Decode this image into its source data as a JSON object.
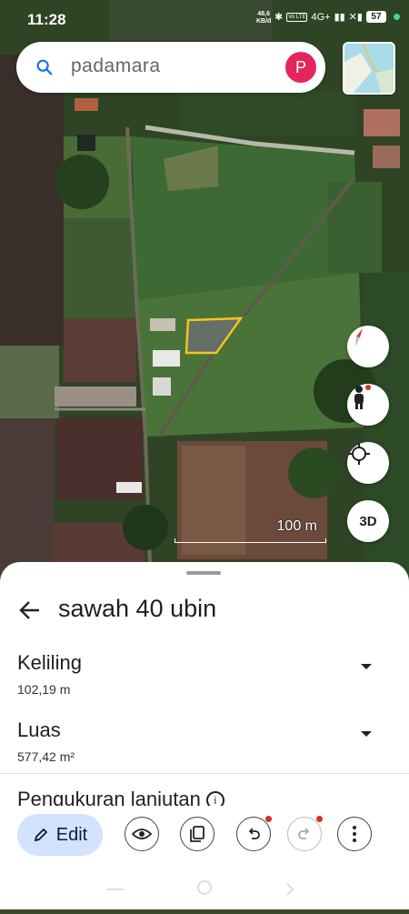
{
  "status_bar": {
    "time": "11:28",
    "net_speed": "48,6",
    "net_unit": "KB/d",
    "volte": "Vo LTE",
    "signal": "4G+",
    "battery": "57"
  },
  "search": {
    "query": "padamara",
    "avatar_letter": "P"
  },
  "map": {
    "scale_label": "100 m",
    "btn_3d": "3D",
    "measured_polygon_color": "#f5c518"
  },
  "sheet": {
    "title": "sawah 40 ubin",
    "rows": [
      {
        "label": "Keliling",
        "value": "102,19 m"
      },
      {
        "label": "Luas",
        "value": "577,42 m²"
      }
    ],
    "next_section": "Pengukuran lanjutan"
  },
  "toolbar": {
    "edit_label": "Edit"
  },
  "colors": {
    "accent": "#1a73e8",
    "edit_bg": "#d3e3fd",
    "avatar": "#e5245c"
  }
}
